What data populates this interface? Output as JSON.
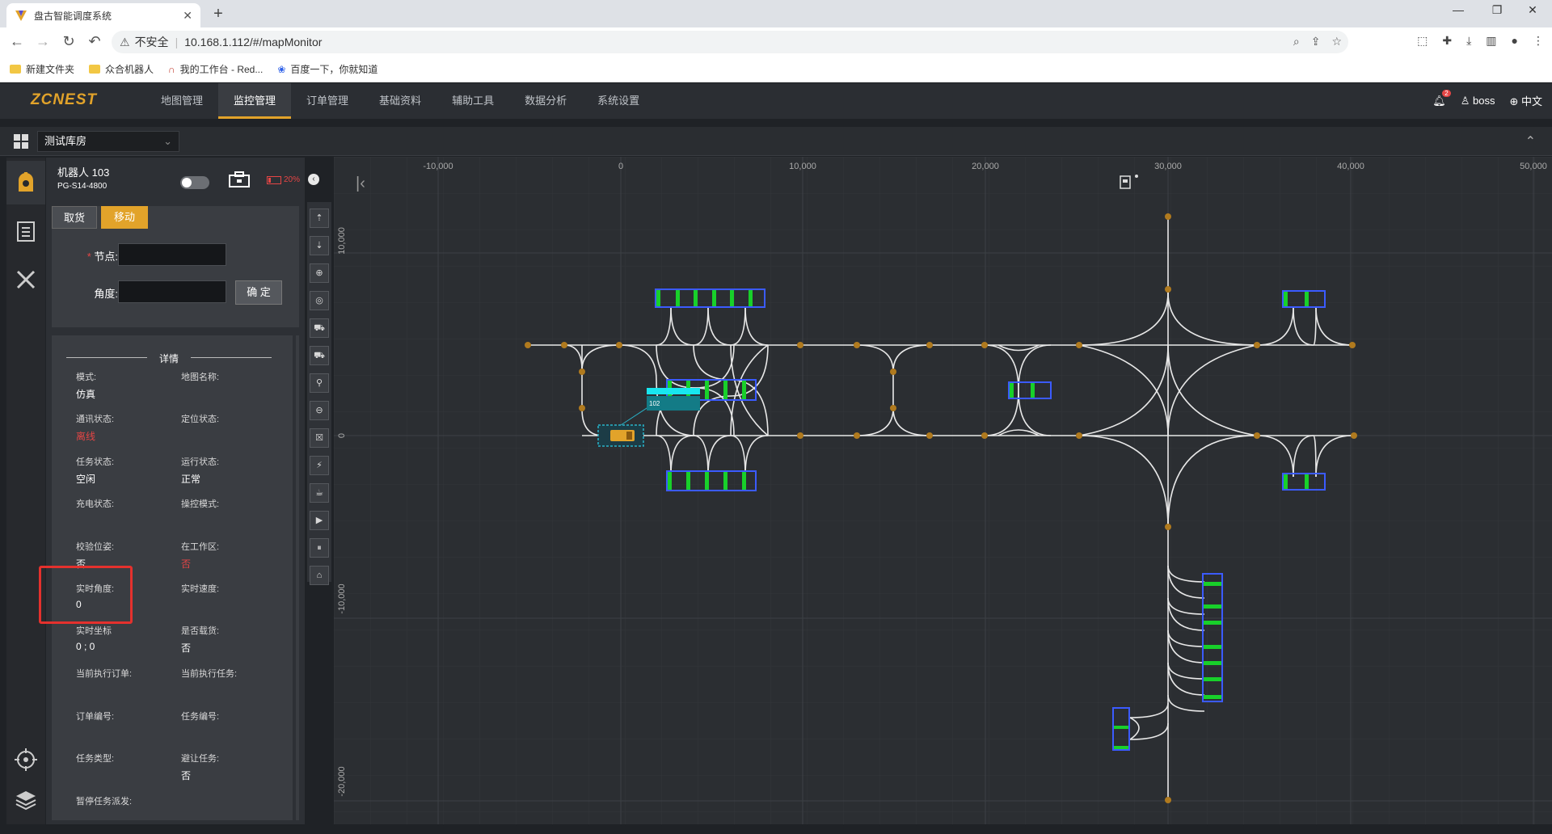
{
  "browser": {
    "tab_title": "盘古智能调度系统",
    "address_security": "不安全",
    "url": "10.168.1.112/#/mapMonitor",
    "bookmarks": [
      "新建文件夹",
      "众合机器人",
      "我的工作台 - Red...",
      "百度一下，你就知道"
    ]
  },
  "app": {
    "brand": "ZCNEST",
    "nav": [
      "地图管理",
      "监控管理",
      "订单管理",
      "基础资料",
      "辅助工具",
      "数据分析",
      "系统设置"
    ],
    "active_nav": "监控管理",
    "notification_count": "2",
    "user": "boss",
    "language": "中文",
    "warehouse": "测试库房"
  },
  "robot": {
    "name": "机器人  103",
    "model": "PG-S14-4800",
    "battery": "20%",
    "buttons": {
      "pick": "取货",
      "move": "移动",
      "confirm": "确 定"
    },
    "fields": {
      "node_label": "节点:",
      "angle_label": "角度:",
      "node_value": "",
      "angle_value": ""
    },
    "detail_title": "详情",
    "details": {
      "mode_label": "模式:",
      "mode_value": "仿真",
      "map_name_label": "地图名称:",
      "map_name_value": "",
      "comm_label": "通讯状态:",
      "comm_value": "离线",
      "loc_label": "定位状态:",
      "loc_value": "",
      "task_state_label": "任务状态:",
      "task_state_value": "空闲",
      "run_state_label": "运行状态:",
      "run_state_value": "正常",
      "charge_label": "充电状态:",
      "charge_value": "",
      "control_label": "操控模式:",
      "control_value": "",
      "check_pose_label": "校验位姿:",
      "check_pose_value": "否",
      "in_work_label": "在工作区:",
      "in_work_value": "否",
      "angle_label": "实时角度:",
      "angle_value": "0",
      "speed_label": "实时速度:",
      "speed_value": "",
      "coord_label": "实时坐标",
      "coord_value": "0 ;  0",
      "loaded_label": "是否载货:",
      "loaded_value": "否",
      "cur_order_label": "当前执行订单:",
      "cur_order_value": "",
      "cur_task_label": "当前执行任务:",
      "cur_task_value": "",
      "order_no_label": "订单编号:",
      "order_no_value": "",
      "task_no_label": "任务编号:",
      "task_no_value": "",
      "task_type_label": "任务类型:",
      "task_type_value": "",
      "avoid_label": "避让任务:",
      "avoid_value": "否",
      "pause_label": "暂停任务派发:"
    }
  },
  "map": {
    "x_ticks": [
      "-10,000",
      "0",
      "10,000",
      "20,000",
      "30,000",
      "40,000",
      "50,000"
    ],
    "y_ticks": [
      "10,000",
      "0",
      "-10,000",
      "-20,000"
    ],
    "robot_label": "102"
  },
  "colors": {
    "accent": "#e2a32a",
    "danger": "#e54545",
    "path": "#e8e8e8",
    "node": "#b07a1e",
    "rack_border": "#3b5bff",
    "rack_fill": "#18d02a"
  }
}
